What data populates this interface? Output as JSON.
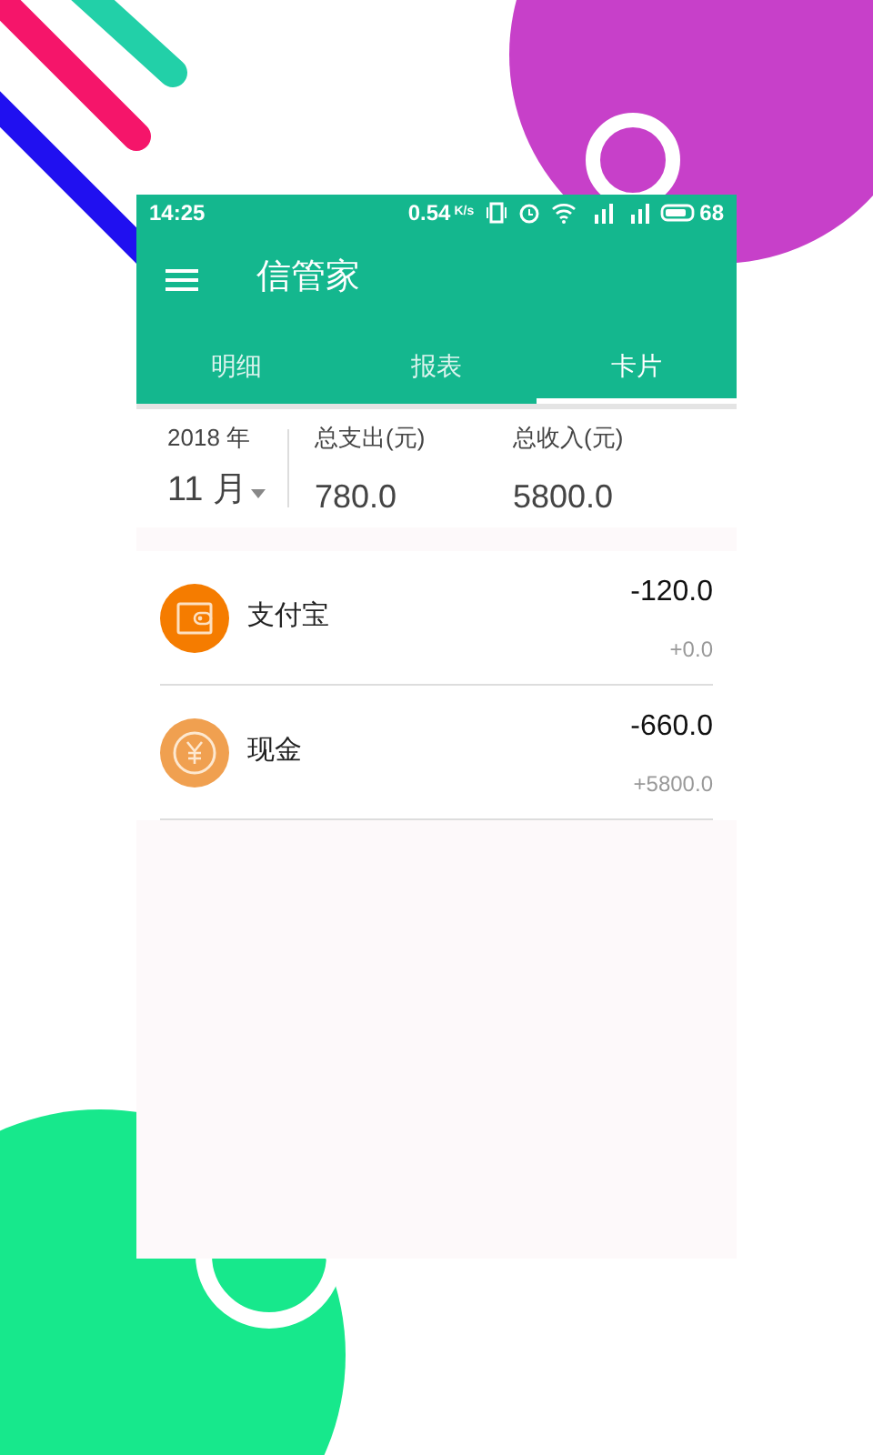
{
  "status_bar": {
    "time": "14:25",
    "speed": "0.54",
    "speed_unit": "K/s",
    "battery": "68"
  },
  "app_bar": {
    "title": "信管家"
  },
  "tabs": [
    {
      "label": "明细",
      "selected": false
    },
    {
      "label": "报表",
      "selected": false
    },
    {
      "label": "卡片",
      "selected": true
    }
  ],
  "summary": {
    "year": "2018 年",
    "month": "11 月",
    "expense_label": "总支出(元)",
    "expense": "780.0",
    "income_label": "总收入(元)",
    "income": "5800.0"
  },
  "accounts": [
    {
      "kind": "wallet",
      "color": "#f57c00",
      "name": "支付宝",
      "amount": "-120.0",
      "income": "+0.0"
    },
    {
      "kind": "cash",
      "color": "#f0a050",
      "name": "现金",
      "amount": "-660.0",
      "income": "+5800.0"
    }
  ]
}
